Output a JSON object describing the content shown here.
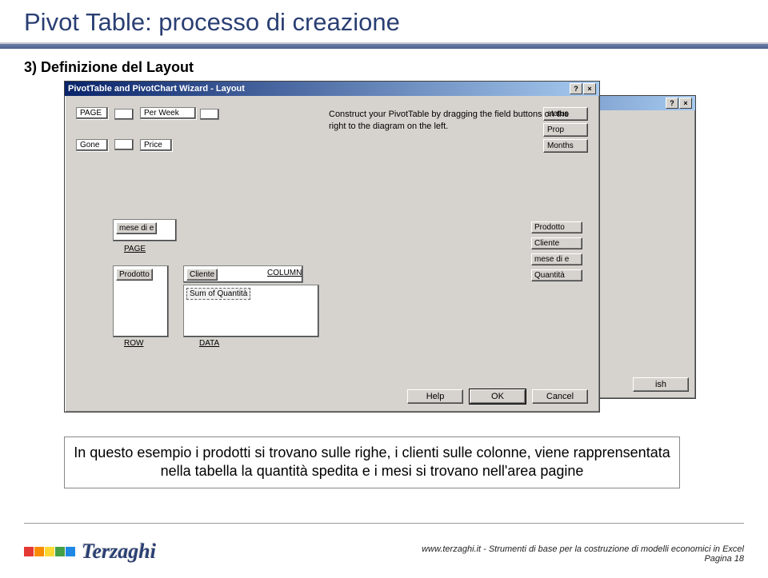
{
  "header": {
    "title": "Pivot Table: processo di creazione"
  },
  "subtitle": "3) Definizione del Layout",
  "front_dialog": {
    "title": "PivotTable and PivotChart Wizard - Layout",
    "instruction": "Construct your PivotTable by dragging the field buttons on the right to the diagram on the left.",
    "diagram": {
      "page": "PAGE",
      "col": "Per Week",
      "row": "Gone",
      "data": "Price"
    },
    "mini_fields": {
      "status": "status",
      "prop": "Prop",
      "months": "Months"
    },
    "layout": {
      "page_label": "PAGE",
      "page_chip": "mese di e",
      "row_label": "ROW",
      "row_chip": "Prodotto",
      "col_label": "COLUMN",
      "col_chip": "Cliente",
      "data_label": "DATA",
      "data_chip": "Sum of Quantità"
    },
    "fields": [
      "Prodotto",
      "Cliente",
      "mese di e",
      "Quantità"
    ],
    "buttons": {
      "help": "Help",
      "ok": "OK",
      "cancel": "Cancel"
    }
  },
  "back_dialog": {
    "help_btn": "?",
    "close_btn": "×",
    "finish": "ish"
  },
  "explain": "In questo esempio i prodotti si trovano sulle righe, i clienti sulle colonne, viene rapprensentata nella tabella la quantità spedita e i mesi si trovano nell'area pagine",
  "footer": {
    "logo_text": "Terzaghi",
    "caption": "www.terzaghi.it - Strumenti di base per la costruzione di modelli economici in Excel",
    "page": "Pagina 18"
  },
  "logo_colors": [
    "#e53935",
    "#fb8c00",
    "#fdd835",
    "#43a047",
    "#1e88e5",
    "#6a1b9a"
  ]
}
